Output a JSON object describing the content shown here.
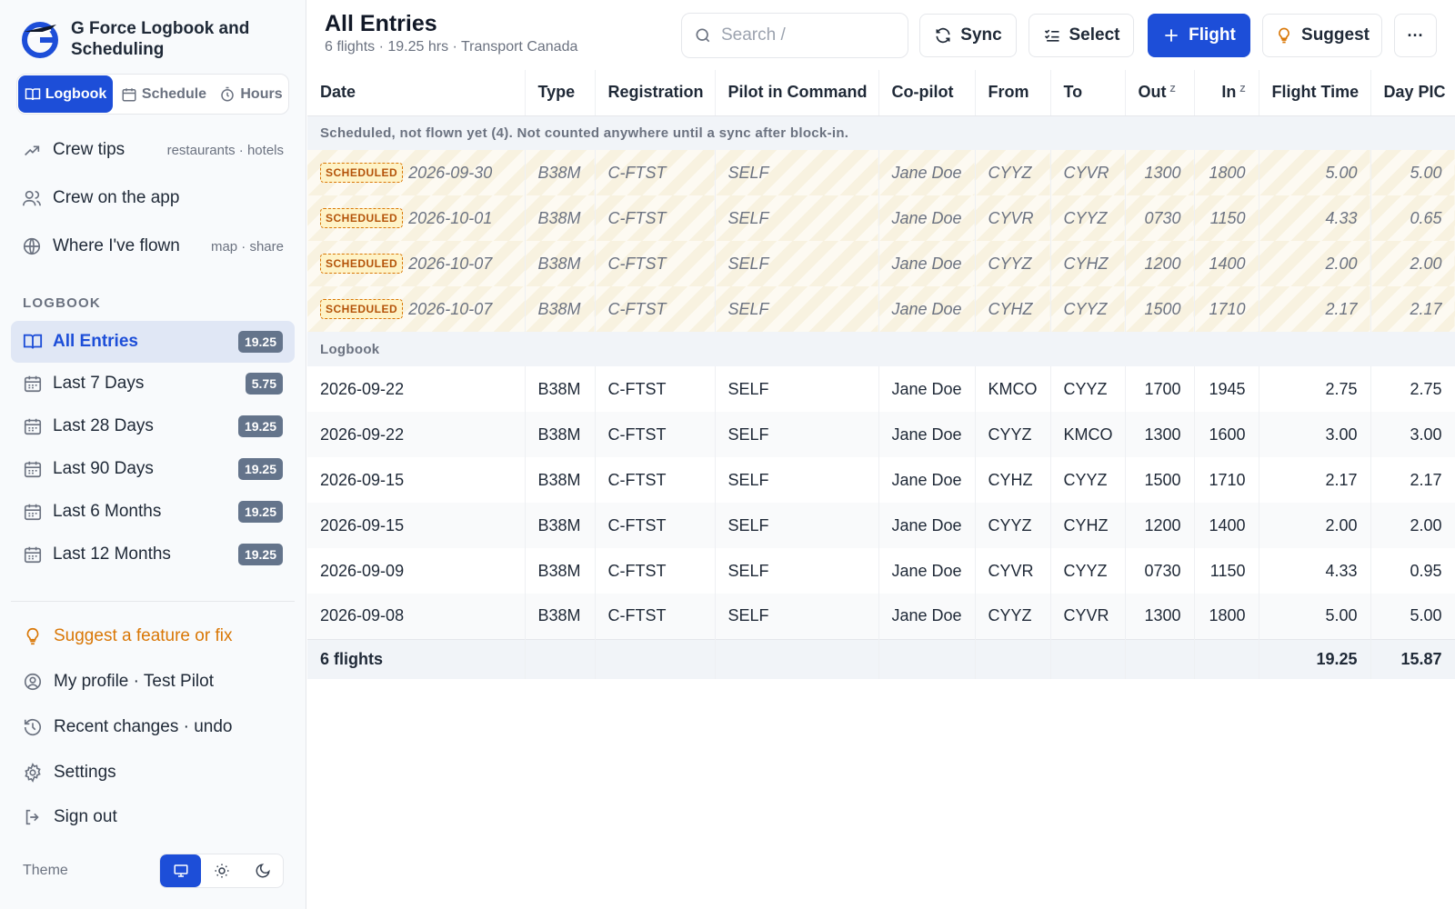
{
  "brand": {
    "name": "G Force Logbook and Scheduling"
  },
  "view_switch": [
    {
      "label": "Logbook",
      "icon": "book-icon",
      "active": true
    },
    {
      "label": "Schedule",
      "icon": "calendar-icon",
      "active": false
    },
    {
      "label": "Hours",
      "icon": "stopwatch-icon",
      "active": false
    }
  ],
  "side_links": {
    "crew_tips": {
      "label": "Crew tips",
      "hint": "restaurants · hotels"
    },
    "crew_app": {
      "label": "Crew on the app"
    },
    "flown": {
      "label": "Where I've flown",
      "hint": "map · share"
    }
  },
  "logbook_section": {
    "title": "LOGBOOK",
    "items": [
      {
        "label": "All Entries",
        "badge": "19.25",
        "active": true
      },
      {
        "label": "Last 7 Days",
        "badge": "5.75"
      },
      {
        "label": "Last 28 Days",
        "badge": "19.25"
      },
      {
        "label": "Last 90 Days",
        "badge": "19.25"
      },
      {
        "label": "Last 6 Months",
        "badge": "19.25"
      },
      {
        "label": "Last 12 Months",
        "badge": "19.25"
      }
    ]
  },
  "bottom_links": {
    "suggest": "Suggest a feature or fix",
    "profile": "My profile · Test Pilot",
    "recent": "Recent changes · undo",
    "settings": "Settings",
    "signout": "Sign out"
  },
  "theme": {
    "label": "Theme",
    "selected": "system"
  },
  "header": {
    "title": "All Entries",
    "subtitle": "6 flights · 19.25 hrs · Transport Canada",
    "search_placeholder": "Search  /",
    "sync": "Sync",
    "select": "Select",
    "flight": "Flight",
    "suggest": "Suggest",
    "more": "···"
  },
  "table": {
    "columns": [
      "Date",
      "Type",
      "Registration",
      "Pilot in Command",
      "Co-pilot",
      "From",
      "To",
      "Out",
      "In",
      "Flight Time",
      "Day PIC"
    ],
    "zulu_marker": "Z",
    "scheduled_note": "Scheduled, not flown yet (4). Not counted anywhere until a sync after block-in.",
    "scheduled_tag": "SCHEDULED",
    "scheduled": [
      [
        "2026-09-30",
        "B38M",
        "C-FTST",
        "SELF",
        "Jane Doe",
        "CYYZ",
        "CYVR",
        "1300",
        "1800",
        "5.00",
        "5.00"
      ],
      [
        "2026-10-01",
        "B38M",
        "C-FTST",
        "SELF",
        "Jane Doe",
        "CYVR",
        "CYYZ",
        "0730",
        "1150",
        "4.33",
        "0.65"
      ],
      [
        "2026-10-07",
        "B38M",
        "C-FTST",
        "SELF",
        "Jane Doe",
        "CYYZ",
        "CYHZ",
        "1200",
        "1400",
        "2.00",
        "2.00"
      ],
      [
        "2026-10-07",
        "B38M",
        "C-FTST",
        "SELF",
        "Jane Doe",
        "CYHZ",
        "CYYZ",
        "1500",
        "1710",
        "2.17",
        "2.17"
      ]
    ],
    "logbook_label": "Logbook",
    "logbook": [
      [
        "2026-09-22",
        "B38M",
        "C-FTST",
        "SELF",
        "Jane Doe",
        "KMCO",
        "CYYZ",
        "1700",
        "1945",
        "2.75",
        "2.75"
      ],
      [
        "2026-09-22",
        "B38M",
        "C-FTST",
        "SELF",
        "Jane Doe",
        "CYYZ",
        "KMCO",
        "1300",
        "1600",
        "3.00",
        "3.00"
      ],
      [
        "2026-09-15",
        "B38M",
        "C-FTST",
        "SELF",
        "Jane Doe",
        "CYHZ",
        "CYYZ",
        "1500",
        "1710",
        "2.17",
        "2.17"
      ],
      [
        "2026-09-15",
        "B38M",
        "C-FTST",
        "SELF",
        "Jane Doe",
        "CYYZ",
        "CYHZ",
        "1200",
        "1400",
        "2.00",
        "2.00"
      ],
      [
        "2026-09-09",
        "B38M",
        "C-FTST",
        "SELF",
        "Jane Doe",
        "CYVR",
        "CYYZ",
        "0730",
        "1150",
        "4.33",
        "0.95"
      ],
      [
        "2026-09-08",
        "B38M",
        "C-FTST",
        "SELF",
        "Jane Doe",
        "CYYZ",
        "CYVR",
        "1300",
        "1800",
        "5.00",
        "5.00"
      ]
    ],
    "totals": {
      "label": "6 flights",
      "flight_time": "19.25",
      "day_pic": "15.87"
    }
  },
  "colors": {
    "accent": "#1d4ed8",
    "suggest": "#d97706",
    "scheduled_tag": "#b45309"
  }
}
